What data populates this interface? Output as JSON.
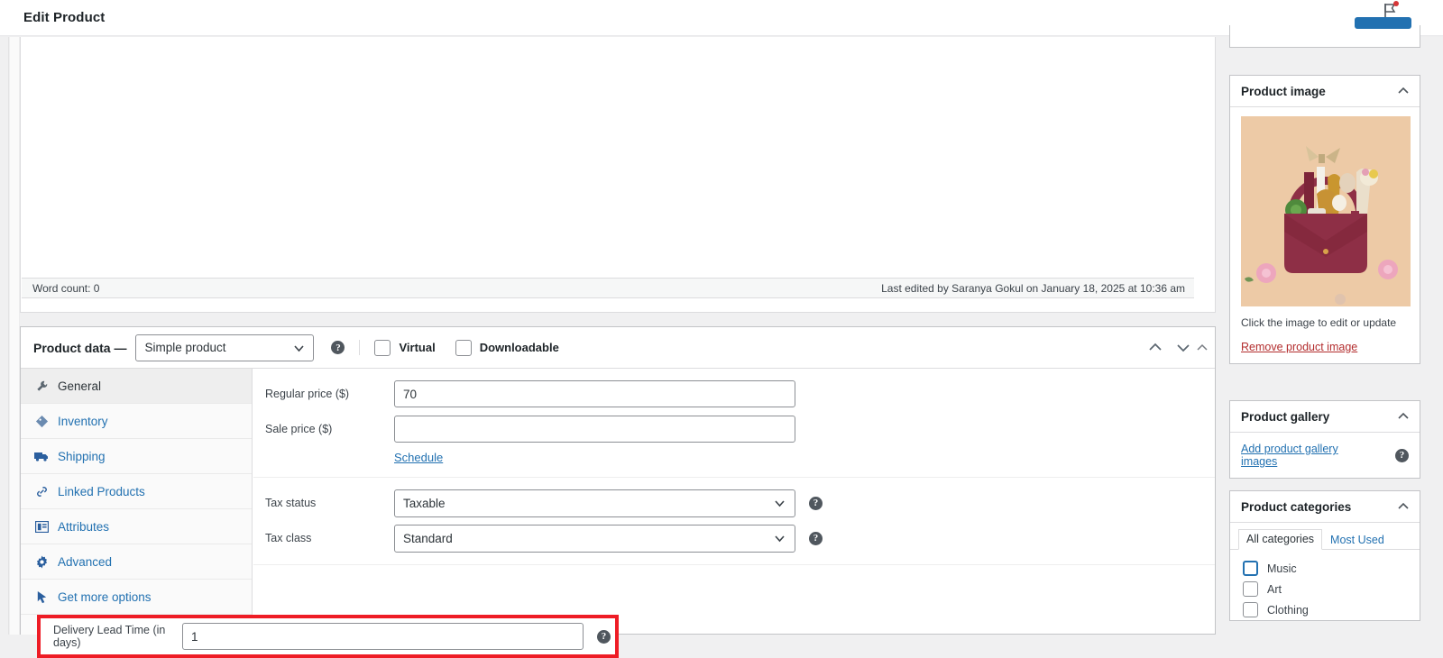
{
  "topbar": {
    "title": "Edit Product",
    "activity": {
      "label": "Activity",
      "icon": "flag-icon",
      "has_notification": true
    }
  },
  "editor": {
    "word_count": "Word count: 0",
    "last_edited": "Last edited by Saranya Gokul on January 18, 2025 at 10:36 am"
  },
  "product_data": {
    "title": "Product data —",
    "type_value": "Simple product",
    "help_icon": "help-icon",
    "virtual_label": "Virtual",
    "virtual_checked": false,
    "downloadable_label": "Downloadable",
    "downloadable_checked": false,
    "tabs": [
      {
        "label": "General",
        "icon": "wrench-icon",
        "active": true
      },
      {
        "label": "Inventory",
        "icon": "tag-icon",
        "active": false
      },
      {
        "label": "Shipping",
        "icon": "truck-icon",
        "active": false
      },
      {
        "label": "Linked Products",
        "icon": "link-icon",
        "active": false
      },
      {
        "label": "Attributes",
        "icon": "attributes-icon",
        "active": false
      },
      {
        "label": "Advanced",
        "icon": "gear-icon",
        "active": false
      },
      {
        "label": "Get more options",
        "icon": "cursor-icon",
        "active": false
      }
    ],
    "fields": {
      "regular_price_label": "Regular price ($)",
      "regular_price_value": "70",
      "sale_price_label": "Sale price ($)",
      "sale_price_value": "",
      "schedule_label": "Schedule",
      "tax_status_label": "Tax status",
      "tax_status_value": "Taxable",
      "tax_class_label": "Tax class",
      "tax_class_value": "Standard",
      "lead_time_label": "Delivery Lead Time (in days)",
      "lead_time_value": "1"
    },
    "highlight_color": "#ee1c25"
  },
  "sidebar": {
    "product_image": {
      "title": "Product image",
      "hint": "Click the image to edit or update",
      "remove_label": "Remove product image",
      "remove_color": "#b32d2e"
    },
    "product_gallery": {
      "title": "Product gallery",
      "add_label": "Add product gallery images"
    },
    "product_categories": {
      "title": "Product categories",
      "tabs": [
        {
          "label": "All categories",
          "active": true
        },
        {
          "label": "Most Used",
          "active": false
        }
      ],
      "items": [
        {
          "label": "Music",
          "checked": false,
          "focused": true
        },
        {
          "label": "Art",
          "checked": false,
          "focused": false
        },
        {
          "label": "Clothing",
          "checked": false,
          "focused": false
        }
      ]
    }
  }
}
